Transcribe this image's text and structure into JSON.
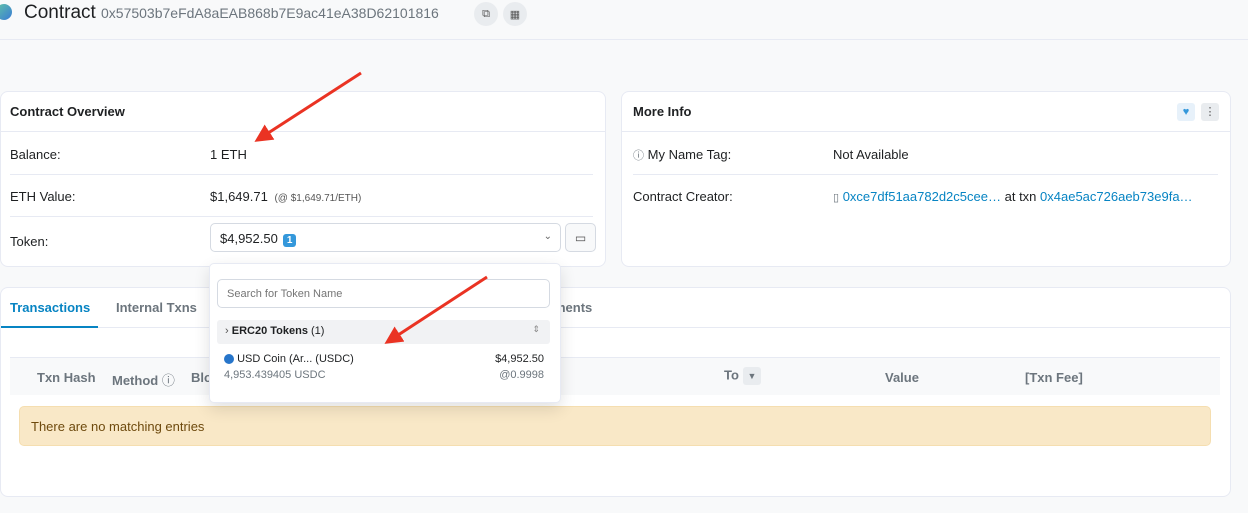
{
  "header": {
    "title": "Contract",
    "address": "0x57503b7eFdA8aEAB868b7E9ac41eA38D62101816"
  },
  "overview": {
    "heading": "Contract Overview",
    "balance_label": "Balance:",
    "balance_value": "1 ETH",
    "eth_value_label": "ETH Value:",
    "eth_value": "$1,649.71",
    "eth_value_note": "(@ $1,649.71/ETH)",
    "token_label": "Token:",
    "token_value": "$4,952.50",
    "token_count": "1"
  },
  "more_info": {
    "heading": "More Info",
    "name_tag_label": "My Name Tag:",
    "name_tag_value": "Not Available",
    "creator_label": "Contract Creator:",
    "creator_address": "0xce7df51aa782d2c5cee…",
    "creator_at_txn": "at txn",
    "creator_txn": "0x4ae5ac726aeb73e9fa…"
  },
  "tabs": {
    "transactions": "Transactions",
    "internal": "Internal Txns",
    "partial": "ments"
  },
  "table": {
    "headers": [
      "Txn Hash",
      "Method",
      "Blo",
      "To",
      "Value",
      "[Txn Fee]"
    ],
    "empty_message": "There are no matching entries"
  },
  "token_dropdown": {
    "search_placeholder": "Search for Token Name",
    "group_label": "ERC20 Tokens",
    "group_count": "(1)",
    "items": [
      {
        "name": "USD Coin (Ar... (USDC)",
        "amount": "4,953.439405 USDC",
        "value": "$4,952.50",
        "rate": "@0.9998"
      }
    ]
  },
  "colors": {
    "link": "#0784c3",
    "accent": "#3498db",
    "arrow": "#ea3323",
    "alert_bg": "#f9e8c7"
  }
}
